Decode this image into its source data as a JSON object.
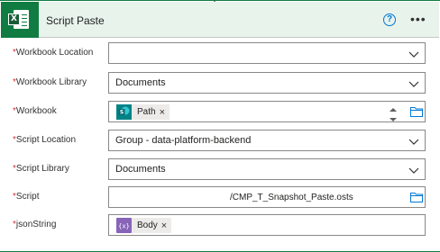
{
  "header": {
    "title": "Script Paste",
    "help_icon": "help-circle-icon",
    "more_icon": "more-options-icon",
    "brand_color": "#107c41"
  },
  "fields": {
    "workbook_location": {
      "label": "Workbook Location",
      "value": ""
    },
    "workbook_library": {
      "label": "Workbook Library",
      "value": "Documents"
    },
    "workbook": {
      "label": "Workbook",
      "token": "Path",
      "token_icon": "sharepoint-icon"
    },
    "script_location": {
      "label": "Script Location",
      "value": "Group - data-platform-backend"
    },
    "script_library": {
      "label": "Script Library",
      "value": "Documents"
    },
    "script": {
      "label": "Script",
      "value": "/CMP_T_Snapshot_Paste.osts"
    },
    "json_string": {
      "label": "jsonString",
      "token": "Body",
      "token_icon": "expression-icon"
    }
  },
  "required_marker": "*"
}
